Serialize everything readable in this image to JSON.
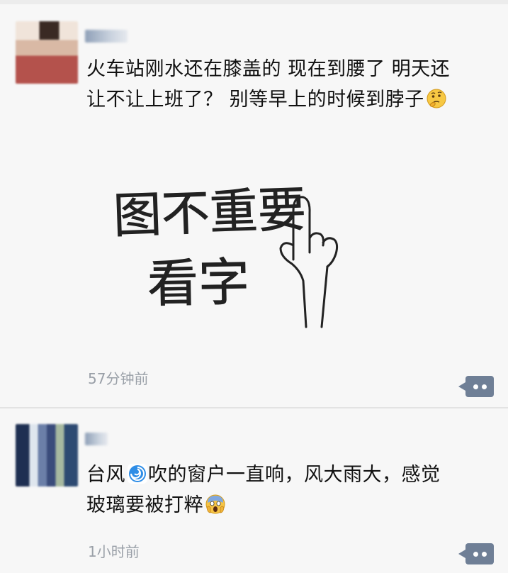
{
  "feed": {
    "posts": [
      {
        "user_name": "",
        "text_line1": "火车站刚水还在膝盖的 现在到腰了 明天还",
        "text_line2": "让不让上班了？ 别等早上的时候到脖子",
        "trailing_emoji": "thinking-face-icon",
        "image_text_line1": "图不重要",
        "image_text_line2": "看字",
        "time": "57分钟前"
      },
      {
        "user_name": "",
        "text_line1_before_emoji": "台风",
        "inline_emoji": "cyclone-icon",
        "text_line1_after_emoji": "吹的窗户一直响，风大雨大，感觉",
        "text_line2": "玻璃要被打粹",
        "trailing_emoji": "screaming-face-icon",
        "time": "1小时前"
      }
    ]
  },
  "colors": {
    "background": "#f7f7f7",
    "text": "#111111",
    "timestamp": "#9aa0a8",
    "comment_button": "#6f7f96",
    "divider": "#e3e3e3"
  }
}
